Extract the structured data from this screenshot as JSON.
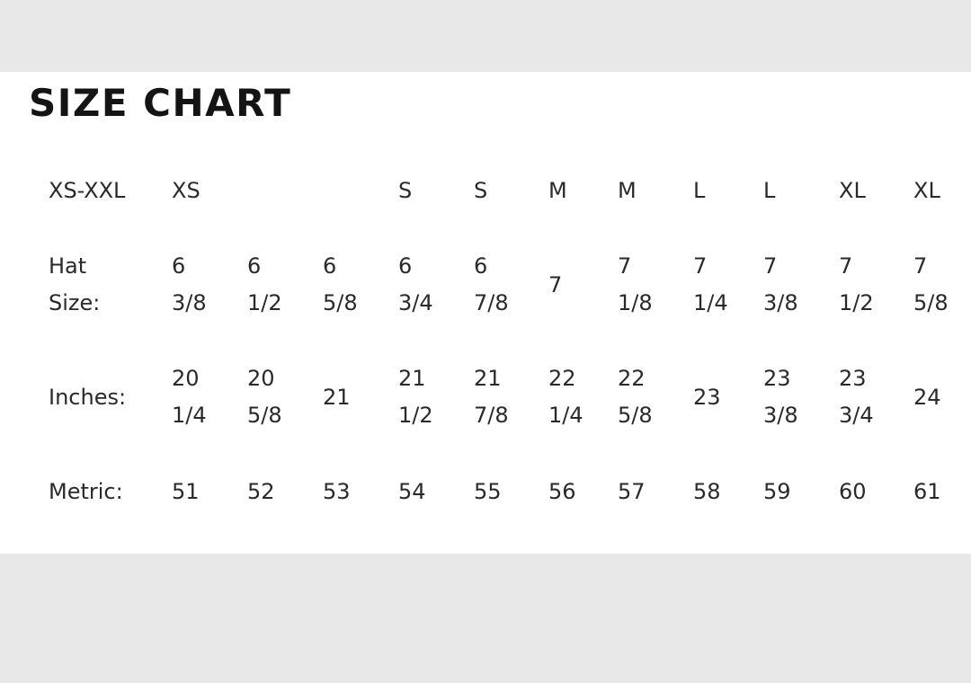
{
  "title": "SIZE CHART",
  "rows": {
    "size": {
      "label": "XS-XXL",
      "values": [
        "XS",
        "",
        "",
        "S",
        "S",
        "M",
        "M",
        "L",
        "L",
        "XL",
        "XL"
      ]
    },
    "hat": {
      "label_line1": "Hat",
      "label_line2": "Size:",
      "values": [
        [
          "6",
          "3/8"
        ],
        [
          "6",
          "1/2"
        ],
        [
          "6",
          "5/8"
        ],
        [
          "6",
          "3/4"
        ],
        [
          "6",
          "7/8"
        ],
        [
          "7"
        ],
        [
          "7",
          "1/8"
        ],
        [
          "7",
          "1/4"
        ],
        [
          "7",
          "3/8"
        ],
        [
          "7",
          "1/2"
        ],
        [
          "7",
          "5/8"
        ]
      ]
    },
    "inches": {
      "label": "Inches:",
      "values": [
        [
          "20",
          "1/4"
        ],
        [
          "20",
          "5/8"
        ],
        [
          "21"
        ],
        [
          "21",
          "1/2"
        ],
        [
          "21",
          "7/8"
        ],
        [
          "22",
          "1/4"
        ],
        [
          "22",
          "5/8"
        ],
        [
          "23"
        ],
        [
          "23",
          "3/8"
        ],
        [
          "23",
          "3/4"
        ],
        [
          "24"
        ]
      ]
    },
    "metric": {
      "label": "Metric:",
      "values": [
        "51",
        "52",
        "53",
        "54",
        "55",
        "56",
        "57",
        "58",
        "59",
        "60",
        "61"
      ]
    }
  }
}
